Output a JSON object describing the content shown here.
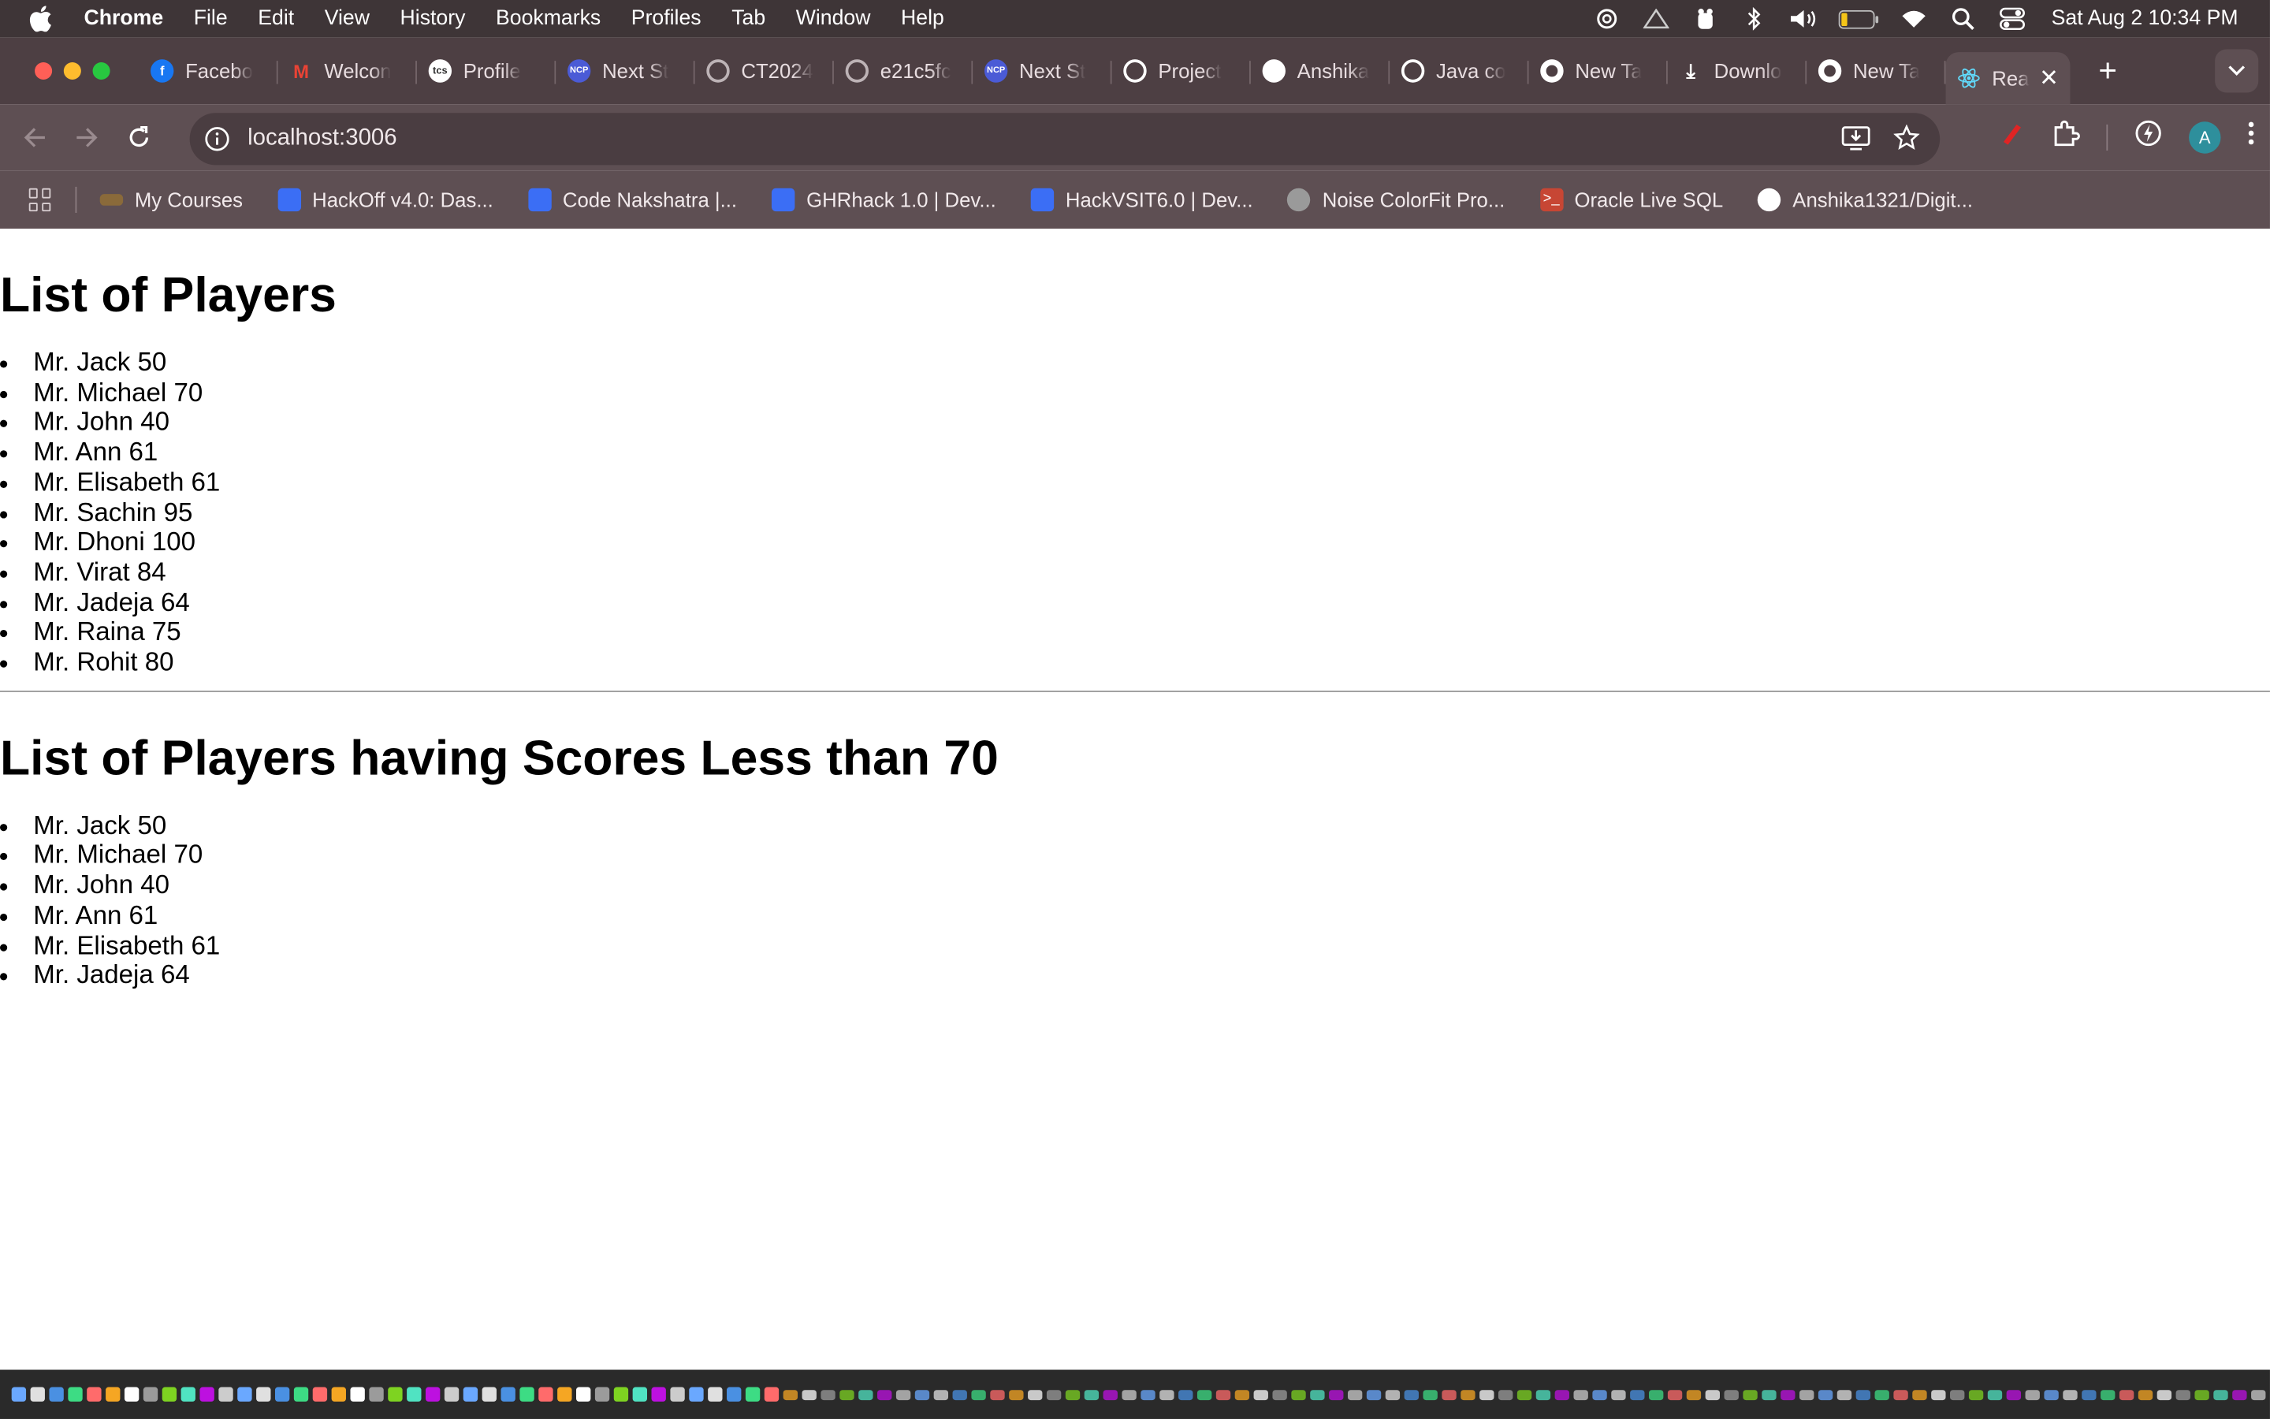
{
  "menubar": {
    "app": "Chrome",
    "items": [
      "File",
      "Edit",
      "View",
      "History",
      "Bookmarks",
      "Profiles",
      "Tab",
      "Window",
      "Help"
    ],
    "clock": "Sat Aug 2  10:34 PM"
  },
  "tabs": [
    {
      "title": "Facebo",
      "icon": "facebook-icon",
      "color": "#1877f2"
    },
    {
      "title": "Welcon",
      "icon": "gmail-icon",
      "color": "#ea4335"
    },
    {
      "title": "Profile",
      "icon": "tcs-icon",
      "color": "#ffffff"
    },
    {
      "title": "Next St",
      "icon": "ncp-icon",
      "color": "#4b5bd6"
    },
    {
      "title": "CT2024",
      "icon": "globe-icon",
      "color": "#bdb3b6"
    },
    {
      "title": "e21c5fc",
      "icon": "globe-icon",
      "color": "#bdb3b6"
    },
    {
      "title": "Next St",
      "icon": "ncp-icon",
      "color": "#4b5bd6"
    },
    {
      "title": "Project",
      "icon": "openai-icon",
      "color": "#ffffff"
    },
    {
      "title": "Anshika",
      "icon": "github-icon",
      "color": "#ffffff"
    },
    {
      "title": "Java co",
      "icon": "openai-icon",
      "color": "#ffffff"
    },
    {
      "title": "New Ta",
      "icon": "chrome-icon",
      "color": "#ffffff"
    },
    {
      "title": "Downlo",
      "icon": "download-icon",
      "color": "#ffffff"
    },
    {
      "title": "New Ta",
      "icon": "chrome-icon",
      "color": "#ffffff"
    }
  ],
  "active_tab": {
    "title": "Rea",
    "icon": "react-icon"
  },
  "omnibox": {
    "url": "localhost:3006"
  },
  "profile_initial": "A",
  "bookmarks": [
    {
      "label": "My Courses",
      "color": "#8a6a3a"
    },
    {
      "label": "HackOff v4.0: Das...",
      "color": "#3b6ef5"
    },
    {
      "label": "Code Nakshatra |...",
      "color": "#3b6ef5"
    },
    {
      "label": "GHRhack 1.0 | Dev...",
      "color": "#3b6ef5"
    },
    {
      "label": "HackVSIT6.0 | Dev...",
      "color": "#3b6ef5"
    },
    {
      "label": "Noise ColorFit Pro...",
      "color": "#9a9a9a"
    },
    {
      "label": "Oracle Live SQL",
      "color": "#c74634"
    },
    {
      "label": "Anshika1321/Digit...",
      "color": "#ffffff"
    }
  ],
  "page": {
    "heading_all": "List of Players",
    "players": [
      "Mr. Jack 50",
      "Mr. Michael 70",
      "Mr. John 40",
      "Mr. Ann 61",
      "Mr. Elisabeth 61",
      "Mr. Sachin 95",
      "Mr. Dhoni 100",
      "Mr. Virat 84",
      "Mr. Jadeja 64",
      "Mr. Raina 75",
      "Mr. Rohit 80"
    ],
    "heading_filtered": "List of Players having Scores Less than 70",
    "filtered_players": [
      "Mr. Jack 50",
      "Mr. Michael 70",
      "Mr. John 40",
      "Mr. Ann 61",
      "Mr. Elisabeth 61",
      "Mr. Jadeja 64"
    ]
  }
}
